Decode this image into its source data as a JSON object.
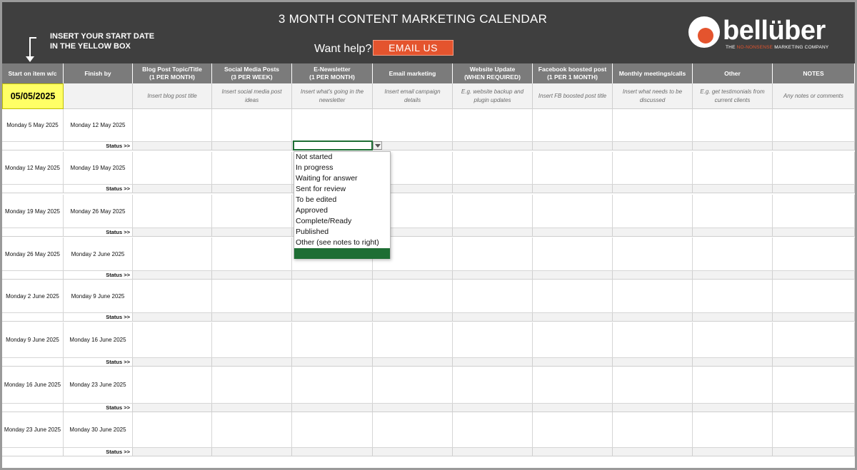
{
  "banner": {
    "title": "3 MONTH CONTENT MARKETING CALENDAR",
    "instruction_line1": "INSERT YOUR START DATE",
    "instruction_line2": "IN THE YELLOW BOX",
    "help_text": "Want help?",
    "email_button": "EMAIL US"
  },
  "logo": {
    "text": "bellüber",
    "tagline_prefix": "THE ",
    "tagline_accent": "NO-NONSENSE",
    "tagline_suffix": " MARKETING COMPANY"
  },
  "colors": {
    "banner": "#3f3f3f",
    "header": "#7b7b7b",
    "accent": "#e4542e",
    "date_highlight": "#ffff66",
    "selection": "#1e6e34"
  },
  "columns": [
    {
      "line1": "Start on item w/c",
      "line2": ""
    },
    {
      "line1": "Finish by",
      "line2": ""
    },
    {
      "line1": "Blog Post Topic/Title",
      "line2": "(1 PER MONTH)"
    },
    {
      "line1": "Social Media Posts",
      "line2": "(3 PER WEEK)"
    },
    {
      "line1": "E-Newsletter",
      "line2": "(1 PER MONTH)"
    },
    {
      "line1": "Email marketing",
      "line2": ""
    },
    {
      "line1": "Website Update",
      "line2": "(WHEN REQUIRED)"
    },
    {
      "line1": "Facebook boosted post",
      "line2": "(1 PER 1 MONTH)"
    },
    {
      "line1": "Monthly meetings/calls",
      "line2": ""
    },
    {
      "line1": "Other",
      "line2": ""
    },
    {
      "line1": "NOTES",
      "line2": ""
    }
  ],
  "start_date": "05/05/2025",
  "placeholders": [
    "Insert blog post title",
    "Insert social media post ideas",
    "Insert what's going in the newsletter",
    "Insert email campaign details",
    "E.g. website backup and plugin updates",
    "Insert FB boosted post title",
    "Insert what needs to be discussed",
    "E.g. get testimonials from current clients",
    "Any notes or comments"
  ],
  "status_label": "Status >>",
  "weeks": [
    {
      "start": "Monday 5 May 2025",
      "finish": "Monday 12 May 2025"
    },
    {
      "start": "Monday 12 May 2025",
      "finish": "Monday 19 May 2025"
    },
    {
      "start": "Monday 19 May 2025",
      "finish": "Monday 26 May 2025"
    },
    {
      "start": "Monday 26 May 2025",
      "finish": "Monday 2 June 2025"
    },
    {
      "start": "Monday 2 June 2025",
      "finish": "Monday 9 June 2025"
    },
    {
      "start": "Monday 9 June 2025",
      "finish": "Monday 16 June 2025"
    },
    {
      "start": "Monday 16 June 2025",
      "finish": "Monday 23 June 2025"
    },
    {
      "start": "Monday 23 June 2025",
      "finish": "Monday 30 June 2025"
    }
  ],
  "status_options": [
    "Not started",
    "In progress",
    "Waiting for answer",
    "Sent for review",
    "To be edited",
    "Approved",
    "Complete/Ready",
    "Published",
    "Other (see notes to right)",
    ""
  ]
}
